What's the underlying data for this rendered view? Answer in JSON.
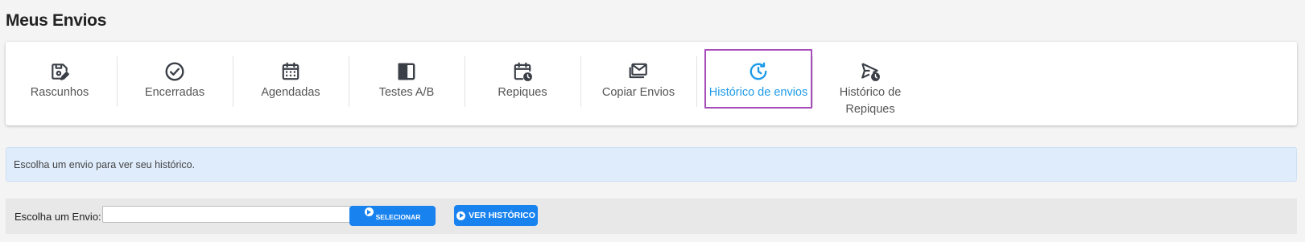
{
  "page": {
    "title": "Meus Envios"
  },
  "tabs": [
    {
      "label": "Rascunhos",
      "icon": "draft-save-edit-icon",
      "active": false
    },
    {
      "label": "Encerradas",
      "icon": "check-circle-icon",
      "active": false
    },
    {
      "label": "Agendadas",
      "icon": "calendar-icon",
      "active": false
    },
    {
      "label": "Testes A/B",
      "icon": "split-square-icon",
      "active": false
    },
    {
      "label": "Repiques",
      "icon": "calendar-clock-icon",
      "active": false
    },
    {
      "label": "Copiar Envios",
      "icon": "mail-stack-icon",
      "active": false
    },
    {
      "label": "Histórico de envios",
      "icon": "history-clock-icon",
      "active": true
    },
    {
      "label": "Histórico de Repiques",
      "icon": "send-clock-icon",
      "active": false
    }
  ],
  "alert": {
    "text": "Escolha um envio para ver seu histórico."
  },
  "select_bar": {
    "label": "Escolha um Envio:",
    "input_value": "",
    "select_button": "SELECIONAR",
    "history_button": "VER HISTÓRICO"
  },
  "colors": {
    "accent": "#1e9be8",
    "button": "#1882ef",
    "active_outline": "#a64db8",
    "icon": "#3a3f47"
  }
}
